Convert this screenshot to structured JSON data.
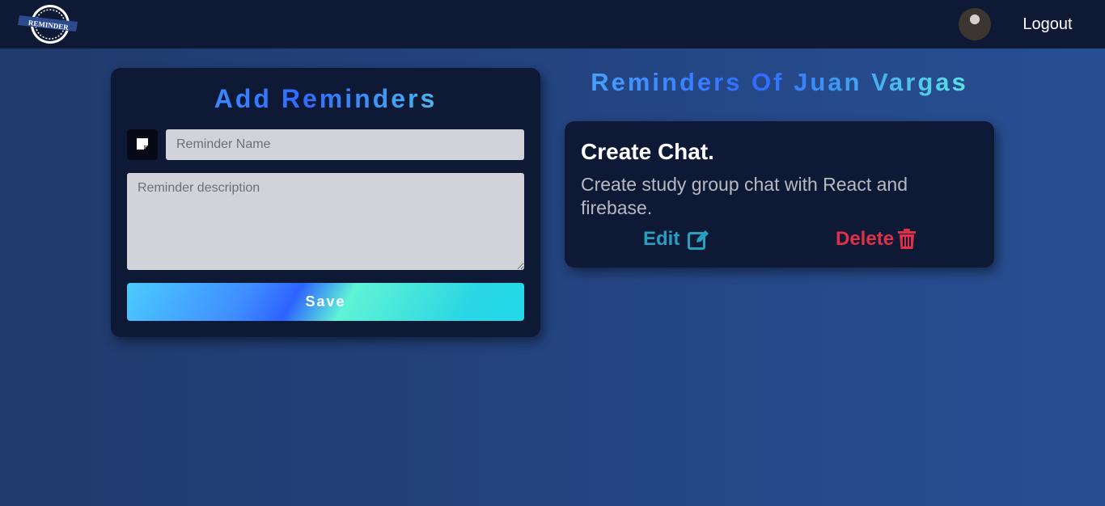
{
  "navbar": {
    "logo_text": "REMINDER",
    "logout_label": "Logout"
  },
  "add_form": {
    "title": "Add Reminders",
    "name_placeholder": "Reminder Name",
    "description_placeholder": "Reminder description",
    "save_label": "Save"
  },
  "list": {
    "title": "Reminders Of Juan Vargas",
    "items": [
      {
        "name": "Create Chat.",
        "description": "Create study group chat with React and firebase.",
        "edit_label": "Edit",
        "delete_label": "Delete"
      }
    ]
  },
  "colors": {
    "navbar_bg": "#0e1a35",
    "card_bg": "#0e1a35",
    "edit": "#25a0c0",
    "delete": "#e03047"
  },
  "icons": [
    "reminder-logo",
    "avatar",
    "sticky-note-icon",
    "edit-icon",
    "trash-icon"
  ]
}
